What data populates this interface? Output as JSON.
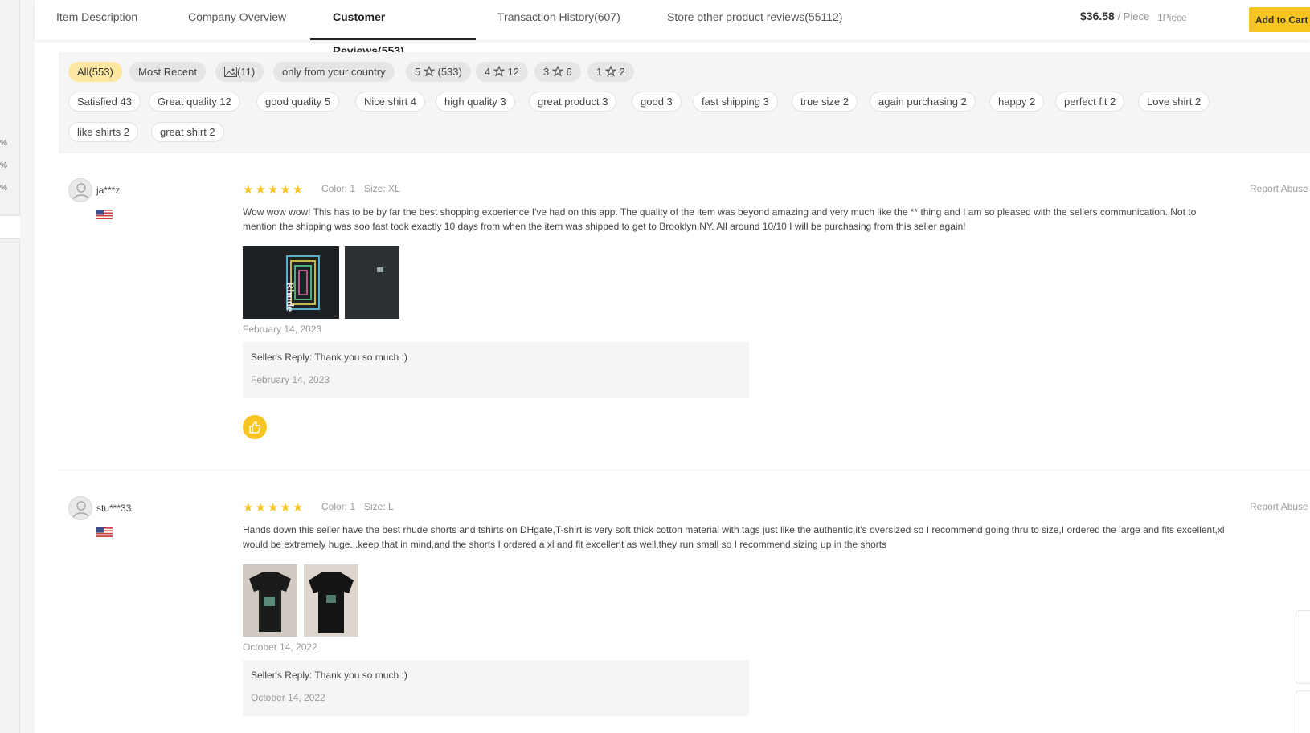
{
  "left_strip": {
    "percents": [
      "%",
      "%",
      "%"
    ]
  },
  "tabs": [
    {
      "label": "Item Description"
    },
    {
      "label": "Company Overview"
    },
    {
      "label": "Customer Reviews(553)"
    },
    {
      "label": "Transaction History(607)"
    },
    {
      "label": "Store other product reviews(55112)"
    }
  ],
  "purchase": {
    "price": "$36.58",
    "unit": "/ Piece",
    "qty": "1Piece",
    "add_to_cart": "Add to Cart"
  },
  "filters": {
    "row1": [
      "All(553)",
      "Most Recent",
      "(11)",
      "only from your country",
      "5",
      "(533)",
      "4",
      "12",
      "3",
      "6",
      "1",
      "2"
    ],
    "tags": [
      "Satisfied 43",
      "Great quality 12",
      "good quality 5",
      "Nice shirt 4",
      "high quality 3",
      "great product 3",
      "good 3",
      "fast shipping 3",
      "true size 2",
      "again purchasing 2",
      "happy 2",
      "perfect fit 2",
      "Love shirt 2",
      "like shirts 2",
      "great shirt 2"
    ]
  },
  "reviews": [
    {
      "user": "ja***z",
      "rating": 5,
      "color": "Color: 1",
      "size": "Size: XL",
      "report": "Report Abuse",
      "text": "Wow wow wow! This has to be by far the best shopping experience I've had on this app. The quality of the item was beyond amazing and very much like the ** thing and I am so pleased with the sellers communication. Not to mention the shipping was soo fast took exactly 10 days from when the item was shipped to get to Brooklyn NY. All around 10/10 I will be purchasing from this seller again!",
      "photo_text": "Rhude",
      "date": "February 14, 2023",
      "reply_label": "Seller's Reply:  Thank you so much :)",
      "reply_date": "February 14, 2023"
    },
    {
      "user": "stu***33",
      "rating": 5,
      "color": "Color: 1",
      "size": "Size: L",
      "report": "Report Abuse",
      "text": "Hands down this seller have the best rhude shorts and tshirts on DHgate,T-shirt is very soft thick cotton material with tags just like the authentic,it's oversized so I recommend going thru to size,I ordered the large and fits excellent,xl would be extremely huge...keep that in mind,and the shorts I ordered a xl and fit excellent as well,they run small so I recommend sizing up in the shorts",
      "date": "October 14, 2022",
      "reply_label": "Seller's Reply:  Thank you so much :)",
      "reply_date": "October 14, 2022"
    }
  ],
  "colors": {
    "accent": "#f7c520",
    "chip_active": "#fde7a2",
    "star": "#f7c520"
  }
}
